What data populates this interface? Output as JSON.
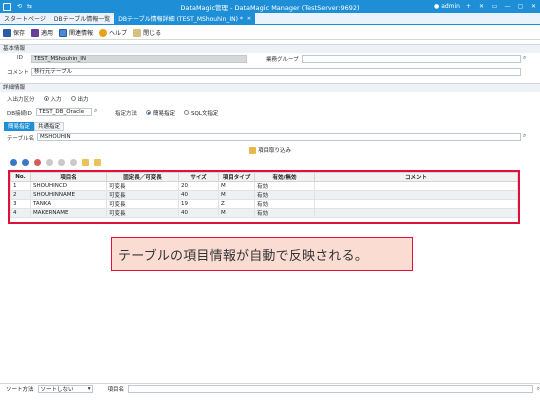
{
  "window": {
    "title": "DataMagic管理 - DataMagic Manager (TestServer:9692)",
    "user": "admin",
    "quick_access": [
      "⟲",
      "⇆"
    ],
    "controls": [
      "+",
      "✕",
      "▭",
      "—",
      "▢",
      "✕"
    ]
  },
  "tabs": [
    {
      "label": "スタートページ",
      "active": false
    },
    {
      "label": "DBテーブル情報一覧",
      "active": false
    },
    {
      "label": "DBテーブル情報詳細 (TEST_MShouhin_IN) *",
      "active": true,
      "close": "✕"
    }
  ],
  "toolbar": {
    "save": "保存",
    "apply": "適用",
    "related": "関連情報",
    "help": "ヘルプ",
    "close": "閉じる"
  },
  "basic_info": {
    "heading": "基本情報",
    "id_label": "ID",
    "id_value": "TEST_MShouhin_IN",
    "group_label": "業務グループ",
    "group_value": "",
    "comment_label": "コメント",
    "comment_value": "移行元テーブル"
  },
  "detail_info": {
    "heading": "詳細情報",
    "io_label": "入出力区分",
    "io_options": [
      "入力",
      "出力"
    ],
    "io_selected": 0,
    "db_label": "DB接続ID",
    "db_value": "TEST_DB_Oracle",
    "method_label": "指定方法",
    "method_options": [
      "簡易指定",
      "SQL文指定"
    ],
    "method_selected": 0
  },
  "subtabs": [
    "簡易指定",
    "共通指定"
  ],
  "table_name": {
    "label": "テーブル名",
    "value": "MSHOUHIN"
  },
  "import_button": "項目取り込み",
  "grid": {
    "columns": [
      "No.",
      "項目名",
      "固定長／可変長",
      "サイズ",
      "項目タイプ",
      "有効/無効",
      "コメント"
    ],
    "rows": [
      [
        "1",
        "SHOUHINCD",
        "可変長",
        "20",
        "M",
        "有効",
        ""
      ],
      [
        "2",
        "SHOUHINNAME",
        "可変長",
        "40",
        "M",
        "有効",
        ""
      ],
      [
        "3",
        "TANKA",
        "可変長",
        "19",
        "Z",
        "有効",
        ""
      ],
      [
        "4",
        "MAKERNAME",
        "可変長",
        "40",
        "M",
        "有効",
        ""
      ]
    ]
  },
  "callout": "テーブルの項目情報が自動で反映される。",
  "bottom": {
    "sort_label": "ソート方法",
    "sort_value": "ソートしない",
    "item_label": "項目名"
  },
  "colors": {
    "accent": "#1e8fd6",
    "highlight_border": "#e0103a",
    "callout_fill": "#fadcd3"
  }
}
